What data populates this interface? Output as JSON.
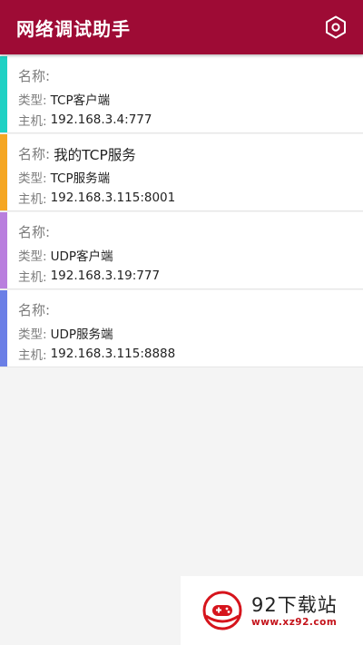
{
  "app": {
    "title": "网络调试助手",
    "accent_color": "#9e0b35",
    "settings_icon": "hexagon-settings-icon"
  },
  "connections": [
    {
      "name_label": "名称:",
      "name": "",
      "type_label": "类型:",
      "type": "TCP客户端",
      "host_label": "主机:",
      "host": "192.168.3.4:777",
      "color": "#1fd1c4"
    },
    {
      "name_label": "名称:",
      "name": "我的TCP服务",
      "type_label": "类型:",
      "type": "TCP服务端",
      "host_label": "主机:",
      "host": "192.168.3.115:8001",
      "color": "#f5a623"
    },
    {
      "name_label": "名称:",
      "name": "",
      "type_label": "类型:",
      "type": "UDP客户端",
      "host_label": "主机:",
      "host": "192.168.3.19:777",
      "color": "#b97fde"
    },
    {
      "name_label": "名称:",
      "name": "",
      "type_label": "类型:",
      "type": "UDP服务端",
      "host_label": "主机:",
      "host": "192.168.3.115:8888",
      "color": "#6b7fe6"
    }
  ],
  "watermark": {
    "brand": "92下载站",
    "url": "www.xz92.com"
  }
}
